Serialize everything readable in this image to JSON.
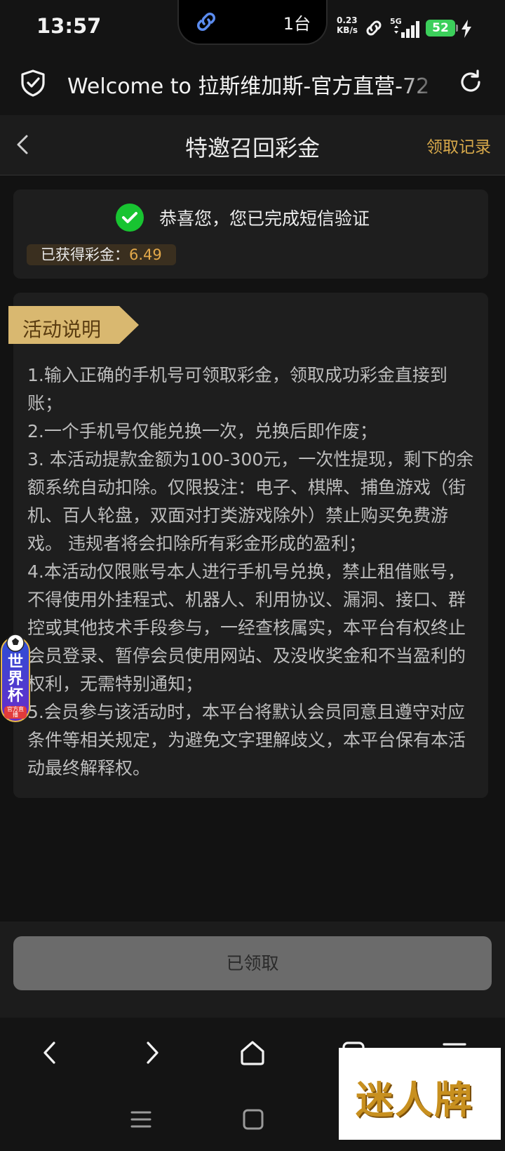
{
  "status_bar": {
    "time": "13:57",
    "island_text": "1台",
    "net_speed_value": "0.23",
    "net_speed_unit": "KB/s",
    "network_type": "5G",
    "battery_level": "52"
  },
  "browser": {
    "url_text": "Welcome to 拉斯维加斯-官方直营-72"
  },
  "header": {
    "title": "特邀召回彩金",
    "records_link": "领取记录"
  },
  "verify_card": {
    "message": "恭喜您，您已完成短信验证",
    "earned_label": "已获得彩金：",
    "earned_value": "6.49"
  },
  "rules_card": {
    "tag": "活动说明",
    "rules": [
      "1.输入正确的手机号可领取彩金，领取成功彩金直接到账；",
      "2.一个手机号仅能兑换一次，兑换后即作废；",
      "3. 本活动提款金额为100-300元，一次性提现，剩下的余额系统自动扣除。仅限投注：电子、棋牌、捕鱼游戏（街机、百人轮盘，双面对打类游戏除外）禁止购买免费游戏。 违规者将会扣除所有彩金形成的盈利；",
      "4.本活动仅限账号本人进行手机号兑换，禁止租借账号，不得使用外挂程式、机器人、利用协议、漏洞、接口、群控或其他技术手段参与，一经查核属实，本平台有权终止会员登录、暂停会员使用网站、及没收奖金和不当盈利的权利，无需特别通知；",
      "5.会员参与该活动时，本平台将默认会员同意且遵守对应条件等相关规定，为避免文字理解歧义，本平台保有本活动最终解释权。"
    ]
  },
  "floating_badge": {
    "title": "世界杯",
    "subtitle": "官方直播"
  },
  "action": {
    "claimed_label": "已领取"
  },
  "watermark": {
    "text": "迷人牌"
  },
  "colors": {
    "accent_gold": "#d6a84a",
    "value_orange": "#e3a94a",
    "success_green": "#18c431",
    "tag_gold": "#d9b870"
  }
}
